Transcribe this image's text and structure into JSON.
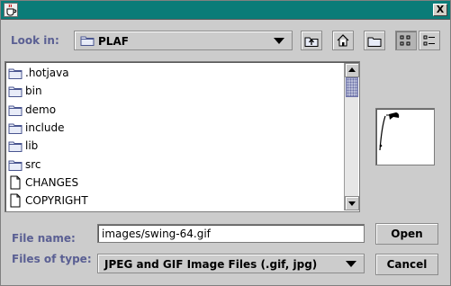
{
  "window": {
    "close_label": "X",
    "app_icon": "java-cup-icon",
    "title_bar_color": "#0a7c78"
  },
  "lookin": {
    "label": "Look in:",
    "value": "PLAF",
    "icon": "folder-icon"
  },
  "toolbar": {
    "buttons": [
      {
        "name": "up-one-level-button",
        "icon": "folder-up-icon"
      },
      {
        "name": "home-button",
        "icon": "home-icon"
      },
      {
        "name": "new-folder-button",
        "icon": "new-folder-icon"
      },
      {
        "name": "list-view-button",
        "icon": "list-view-icon"
      },
      {
        "name": "details-view-button",
        "icon": "details-view-icon"
      }
    ]
  },
  "files": [
    {
      "name": ".hotjava",
      "type": "folder"
    },
    {
      "name": "bin",
      "type": "folder"
    },
    {
      "name": "demo",
      "type": "folder"
    },
    {
      "name": "include",
      "type": "folder"
    },
    {
      "name": "lib",
      "type": "folder"
    },
    {
      "name": "src",
      "type": "folder"
    },
    {
      "name": "CHANGES",
      "type": "file"
    },
    {
      "name": "COPYRIGHT",
      "type": "file"
    }
  ],
  "filename": {
    "label": "File name:",
    "value": "images/swing-64.gif"
  },
  "filetype": {
    "label": "Files of type:",
    "value": "JPEG and GIF Image Files (.gif, jpg)"
  },
  "buttons": {
    "open": "Open",
    "cancel": "Cancel"
  },
  "colors": {
    "label_text": "#5a5f93",
    "background": "#cccccc"
  }
}
